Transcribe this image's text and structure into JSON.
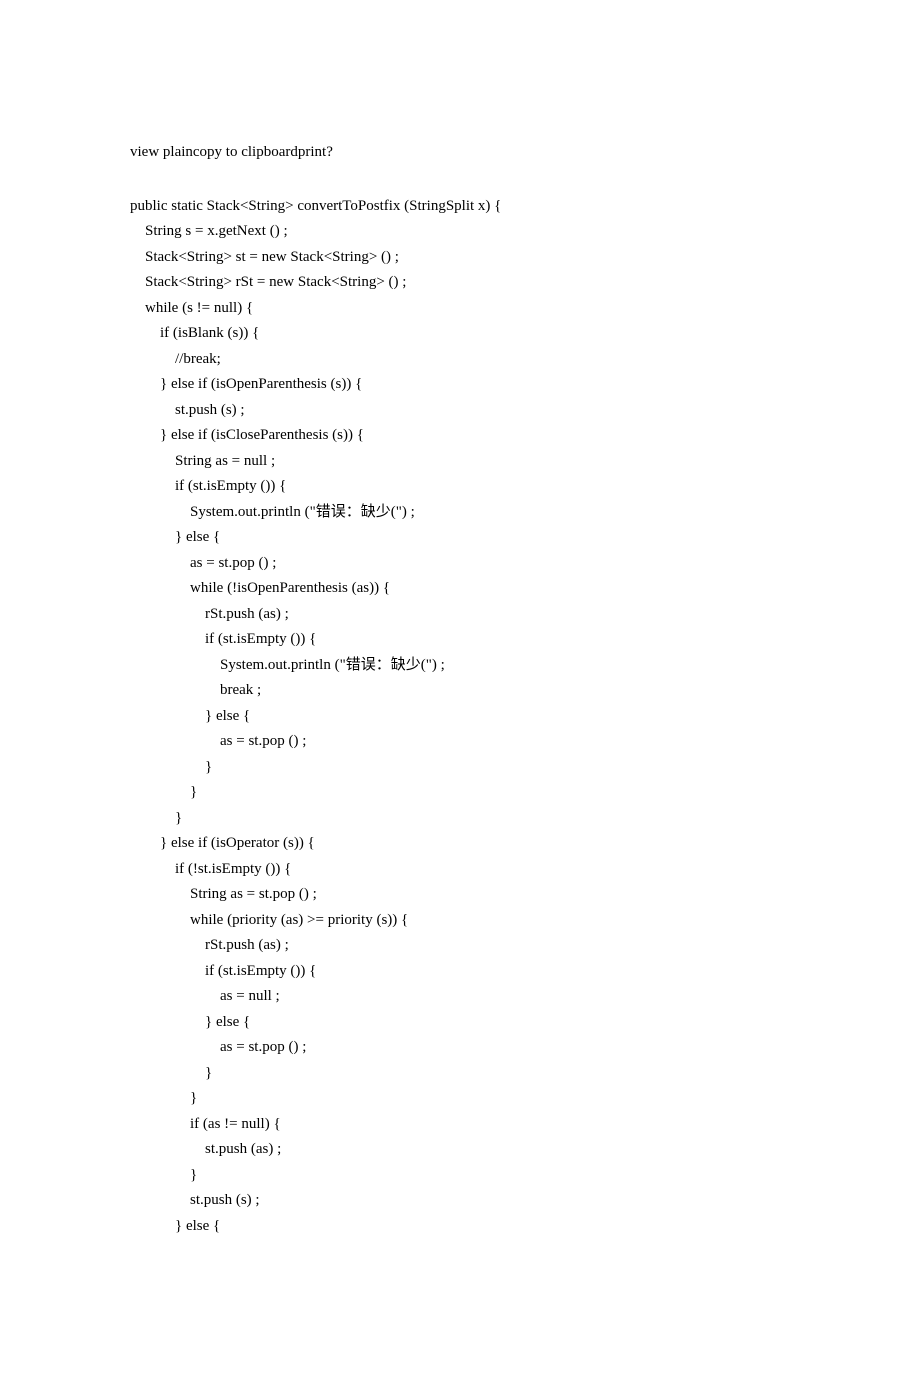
{
  "header": "view plaincopy to clipboardprint?",
  "code_lines": [
    "public static Stack<String> convertToPostfix (StringSplit x) {",
    "    String s = x.getNext () ;",
    "    Stack<String> st = new Stack<String> () ;",
    "    Stack<String> rSt = new Stack<String> () ;",
    "    while (s != null) {",
    "        if (isBlank (s)) {",
    "            //break;",
    "        } else if (isOpenParenthesis (s)) {",
    "            st.push (s) ;",
    "        } else if (isCloseParenthesis (s)) {",
    "            String as = null ;",
    "            if (st.isEmpty ()) {",
    "                System.out.println (\"错误：缺少(\") ;",
    "            } else {",
    "                as = st.pop () ;",
    "                while (!isOpenParenthesis (as)) {",
    "                    rSt.push (as) ;",
    "                    if (st.isEmpty ()) {",
    "                        System.out.println (\"错误：缺少(\") ;",
    "                        break ;",
    "                    } else {",
    "                        as = st.pop () ;",
    "                    }",
    "                }",
    "            }",
    "        } else if (isOperator (s)) {",
    "            if (!st.isEmpty ()) {",
    "                String as = st.pop () ;",
    "                while (priority (as) >= priority (s)) {",
    "                    rSt.push (as) ;",
    "                    if (st.isEmpty ()) {",
    "                        as = null ;",
    "                    } else {",
    "                        as = st.pop () ;",
    "                    }",
    "                }",
    "                if (as != null) {",
    "                    st.push (as) ;",
    "                }",
    "                st.push (s) ;",
    "            } else {"
  ]
}
